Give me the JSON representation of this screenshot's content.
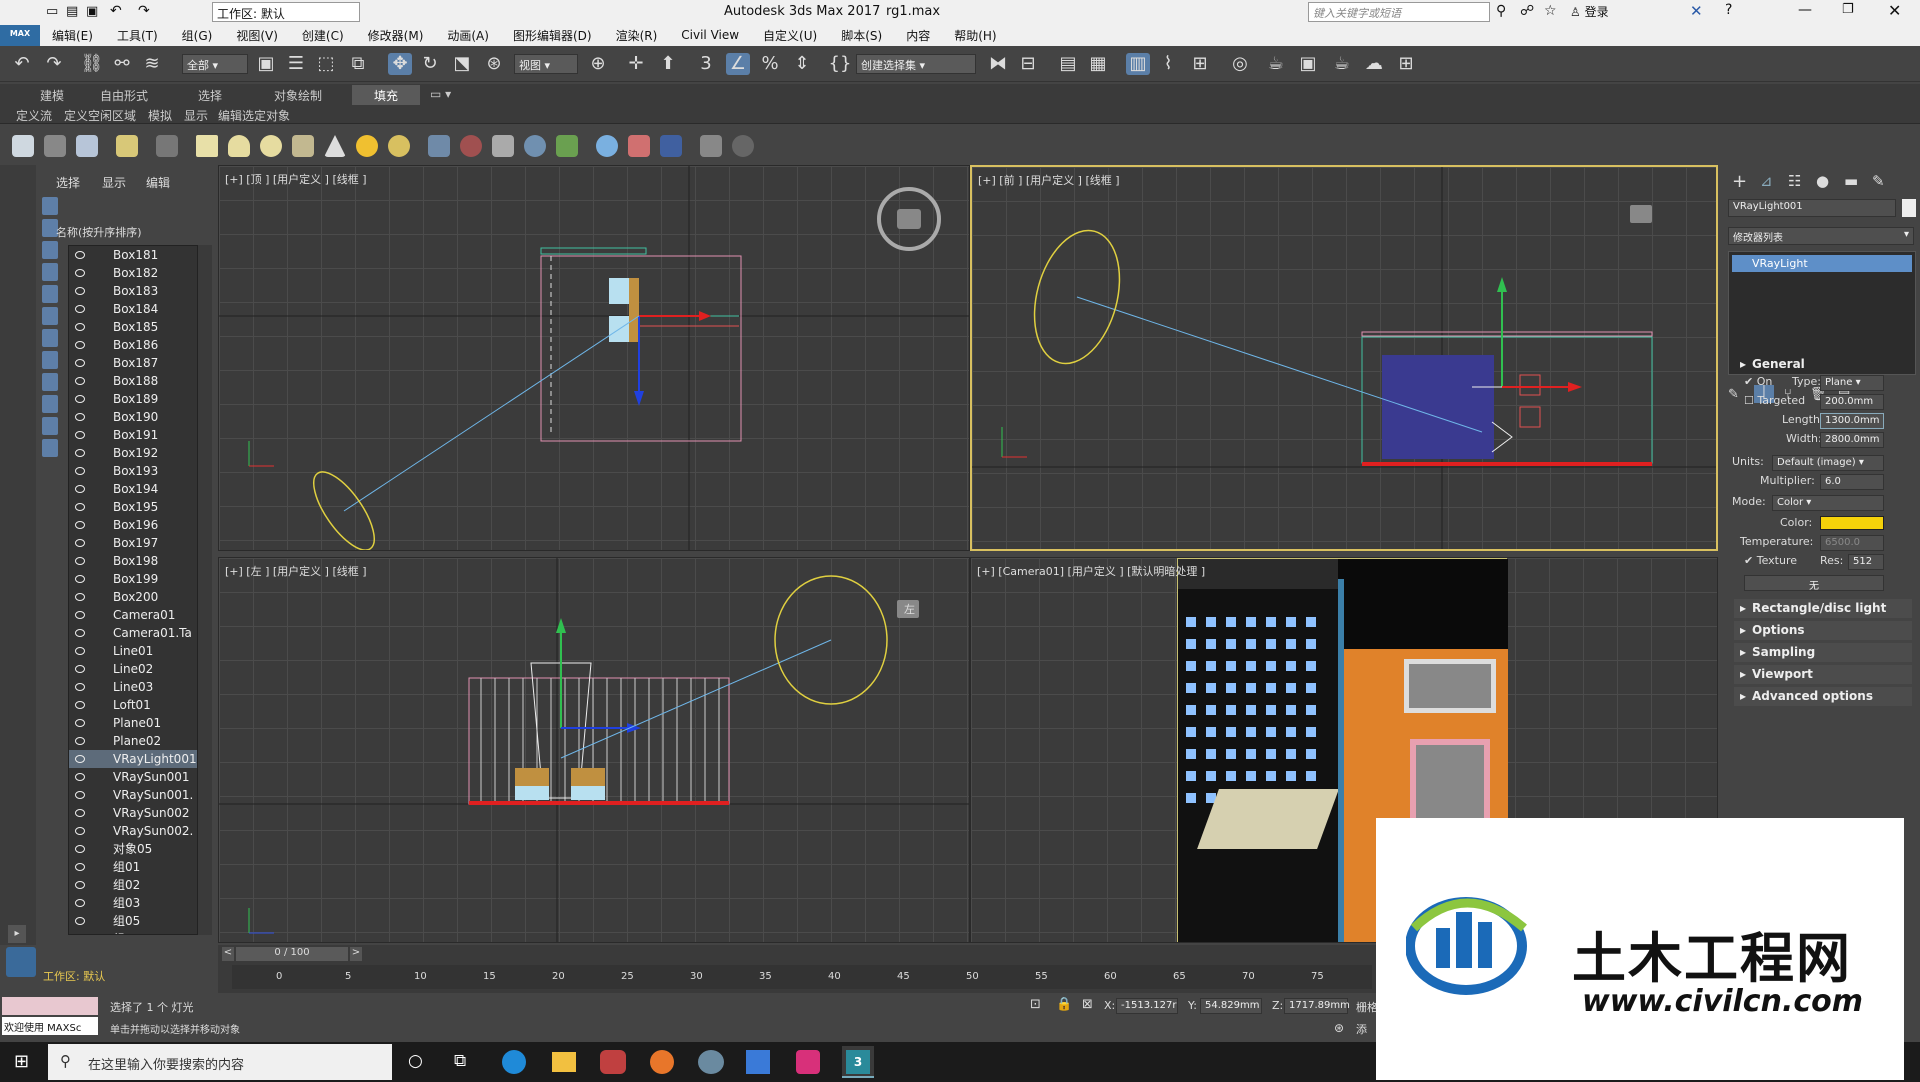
{
  "window": {
    "title": "Autodesk 3ds Max 2017",
    "filename": "rg1.max",
    "workspace": "工作区: 默认",
    "search_placeholder": "键入关键字或短语",
    "login": "登录"
  },
  "menu": [
    "编辑(E)",
    "工具(T)",
    "组(G)",
    "视图(V)",
    "创建(C)",
    "修改器(M)",
    "动画(A)",
    "图形编辑器(D)",
    "渲染(R)",
    "Civil View",
    "自定义(U)",
    "脚本(S)",
    "内容",
    "帮助(H)"
  ],
  "toolbar": {
    "filter": "全部",
    "viewref": "视图",
    "selection_set": "创建选择集"
  },
  "ribbon_tabs": [
    "建模",
    "自由形式",
    "选择",
    "对象绘制",
    "填充"
  ],
  "ribbon_sub": [
    "定义流",
    "定义空闲区域",
    "模拟",
    "显示",
    "编辑选定对象"
  ],
  "explorer": {
    "tabs": [
      "选择",
      "显示",
      "编辑"
    ],
    "header": "名称(按升序排序)",
    "items": [
      "Box181",
      "Box182",
      "Box183",
      "Box184",
      "Box185",
      "Box186",
      "Box187",
      "Box188",
      "Box189",
      "Box190",
      "Box191",
      "Box192",
      "Box193",
      "Box194",
      "Box195",
      "Box196",
      "Box197",
      "Box198",
      "Box199",
      "Box200",
      "Camera01",
      "Camera01.Ta",
      "Line01",
      "Line02",
      "Line03",
      "Loft01",
      "Plane01",
      "Plane02",
      "VRayLight001",
      "VRaySun001",
      "VRaySun001.",
      "VRaySun002",
      "VRaySun002.",
      "对象05",
      "组01",
      "组02",
      "组03",
      "组05",
      "组06"
    ],
    "selected": "VRayLight001",
    "workspace": "工作区: 默认"
  },
  "viewports": {
    "top": "[+] [顶 ] [用户定义 ] [线框 ]",
    "front": "[+] [前 ] [用户定义 ] [线框 ]",
    "left": "[+] [左 ] [用户定义 ] [线框 ]",
    "camera": "[+] [Camera01] [用户定义 ] [默认明暗处理 ]",
    "left_cube": "左",
    "front_cube": "前"
  },
  "command_panel": {
    "object_name": "VRayLight001",
    "modifier_list": "修改器列表",
    "stack_item": "VRayLight",
    "general": {
      "title": "General",
      "on": "On",
      "type_label": "Type:",
      "type": "Plane",
      "targeted": "Targeted",
      "targeted_value": "200.0mm",
      "length_label": "Length:",
      "length": "1300.0mm",
      "width_label": "Width:",
      "width": "2800.0mm",
      "units_label": "Units:",
      "units": "Default (image)",
      "multiplier_label": "Multiplier:",
      "multiplier": "6.0",
      "mode_label": "Mode:",
      "mode": "Color",
      "color_label": "Color:",
      "color": "#f5d20a",
      "temperature_label": "Temperature:",
      "temperature": "6500.0",
      "texture": "Texture",
      "res_label": "Res:",
      "res": "512",
      "none": "无"
    },
    "rollouts": [
      "Rectangle/disc light",
      "Options",
      "Sampling",
      "Viewport",
      "Advanced options"
    ]
  },
  "timeline": {
    "frame": "0 / 100",
    "ticks": [
      "0",
      "5",
      "10",
      "15",
      "20",
      "25",
      "30",
      "35",
      "40",
      "45",
      "50",
      "55",
      "60",
      "65",
      "70",
      "75"
    ]
  },
  "status": {
    "welcome": "欢迎使用 MAXSc",
    "selected": "选择了 1 个 灯光",
    "hint": "单击并拖动以选择并移动对象",
    "x_label": "X:",
    "x": "-1513.127r",
    "y_label": "Y:",
    "y": "54.829mm",
    "z_label": "Z:",
    "z": "1717.89mm",
    "grid": "栅格",
    "add": "添"
  },
  "taskbar": {
    "search_placeholder": "在这里输入你要搜索的内容"
  },
  "watermark": {
    "brand": "土木工程网",
    "url": "www.civilcn.com"
  }
}
